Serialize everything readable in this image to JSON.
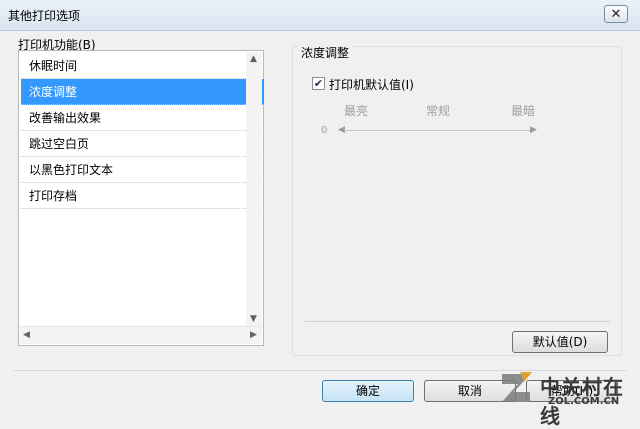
{
  "window": {
    "title": "其他打印选项"
  },
  "function_list": {
    "label": "打印机功能(B)",
    "items": [
      "休眠时间",
      "浓度调整",
      "改善输出效果",
      "跳过空白页",
      "以黑色打印文本",
      "打印存档"
    ],
    "selected": "浓度调整"
  },
  "density": {
    "group_title": "浓度调整",
    "checkbox_label": "打印机默认值(I)",
    "checkbox_checked": true,
    "scale_labels": [
      "最亮",
      "常规",
      "最暗"
    ],
    "slider_value": "0",
    "default_button": "默认值(D)"
  },
  "footer": {
    "ok": "确定",
    "cancel": "取消",
    "help": "帮助(H)"
  },
  "watermark": {
    "line1": "中关村在线",
    "line2": "ZOL.COM.CN"
  }
}
